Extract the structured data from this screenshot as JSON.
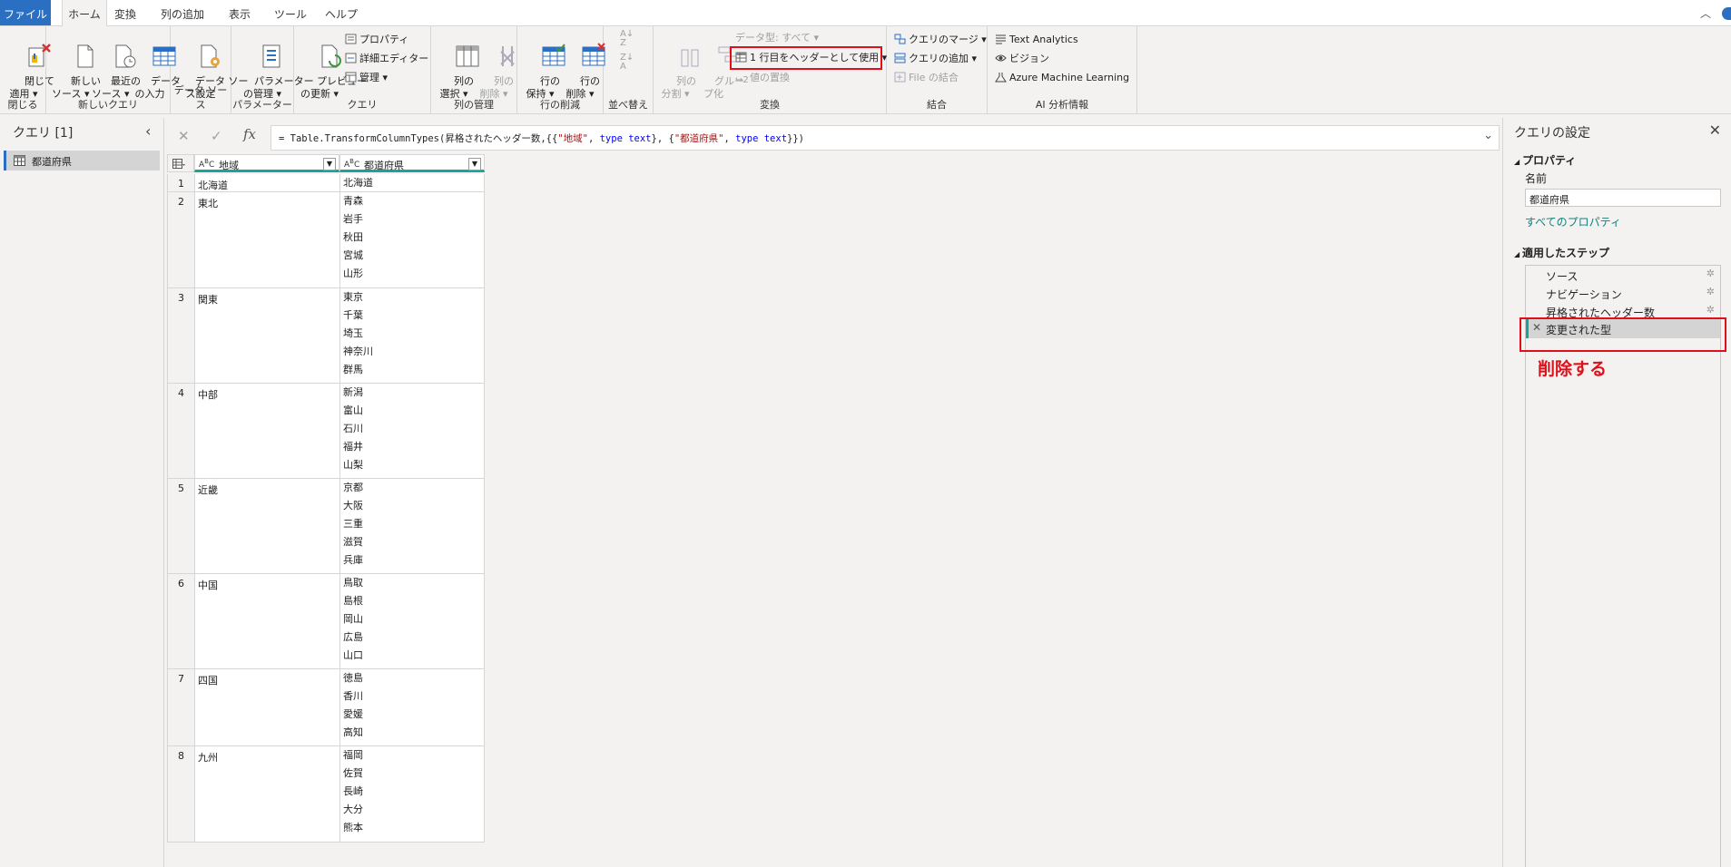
{
  "tabs": [
    "ファイル",
    "ホーム",
    "変換",
    "列の追加",
    "表示",
    "ツール",
    "ヘルプ"
  ],
  "ribbon": {
    "close": {
      "btn": "閉じて\n適用 ▾",
      "group": "閉じる"
    },
    "newquery": {
      "btn1": "新しい\nソース ▾",
      "btn2": "最近の\nソース ▾",
      "btn3": "データ\nの入力",
      "group": "新しいクエリ"
    },
    "datasource": {
      "btn": "データ ソー\nス設定",
      "group": "データ ソース"
    },
    "params": {
      "btn": "パラメーター\nの管理 ▾",
      "group": "パラメーター"
    },
    "query": {
      "btn": "プレビュー\nの更新 ▾",
      "props": "プロパティ",
      "editor": "詳細エディター",
      "manage": "管理 ▾",
      "group": "クエリ"
    },
    "cols": {
      "btn1": "列の\n選択 ▾",
      "btn2": "列の\n削除 ▾",
      "group": "列の管理"
    },
    "rows": {
      "btn1": "行の\n保持 ▾",
      "btn2": "行の\n削除 ▾",
      "group": "行の削減"
    },
    "sort": {
      "group": "並べ替え"
    },
    "transform": {
      "btn1": "列の\n分割 ▾",
      "btn2": "グルー\nプ化",
      "datatype": "データ型: すべて ▾",
      "header": "1 行目をヘッダーとして使用 ▾",
      "replace": "値の置換",
      "group": "変換"
    },
    "combine": {
      "merge": "クエリのマージ ▾",
      "append": "クエリの追加 ▾",
      "file": "File の結合",
      "group": "結合"
    },
    "ai": {
      "text": "Text Analytics",
      "vision": "ビジョン",
      "aml": "Azure Machine Learning",
      "group": "AI 分析情報"
    }
  },
  "left": {
    "title": "クエリ [1]",
    "query": "都道府県"
  },
  "formula": "= Table.TransformColumnTypes(昇格されたヘッダー数,{{\"地域\", type text}, {\"都道府県\", type text}})",
  "formula_parts": {
    "a": "= Table.TransformColumnTypes(昇格されたヘッダー数,{{",
    "s1": "\"地域\"",
    "b": ", ",
    "k1": "type text",
    "c": "}, {",
    "s2": "\"都道府県\"",
    "d": ", ",
    "k2": "type text",
    "e": "}})"
  },
  "grid": {
    "col1": "地域",
    "col2": "都道府県",
    "rows": [
      {
        "n": "1",
        "region": "北海道",
        "prefs": "北海道"
      },
      {
        "n": "2",
        "region": "東北",
        "prefs": "青森\n岩手\n秋田\n宮城\n山形"
      },
      {
        "n": "3",
        "region": "関東",
        "prefs": "東京\n千葉\n埼玉\n神奈川\n群馬"
      },
      {
        "n": "4",
        "region": "中部",
        "prefs": "新潟\n富山\n石川\n福井\n山梨"
      },
      {
        "n": "5",
        "region": "近畿",
        "prefs": "京都\n大阪\n三重\n滋賀\n兵庫"
      },
      {
        "n": "6",
        "region": "中国",
        "prefs": "鳥取\n島根\n岡山\n広島\n山口"
      },
      {
        "n": "7",
        "region": "四国",
        "prefs": "徳島\n香川\n愛媛\n高知"
      },
      {
        "n": "8",
        "region": "九州",
        "prefs": "福岡\n佐賀\n長崎\n大分\n熊本"
      }
    ]
  },
  "right": {
    "title": "クエリの設定",
    "props": "プロパティ",
    "name_label": "名前",
    "name_value": "都道府県",
    "all_props": "すべてのプロパティ",
    "steps_title": "適用したステップ",
    "steps": [
      "ソース",
      "ナビゲーション",
      "昇格されたヘッダー数",
      "変更された型"
    ],
    "annotation": "削除する"
  },
  "colors": {
    "accent": "#2b6fc3",
    "highlight": "#e0101b",
    "teal": "#1aa39b",
    "link": "#127f7a"
  }
}
